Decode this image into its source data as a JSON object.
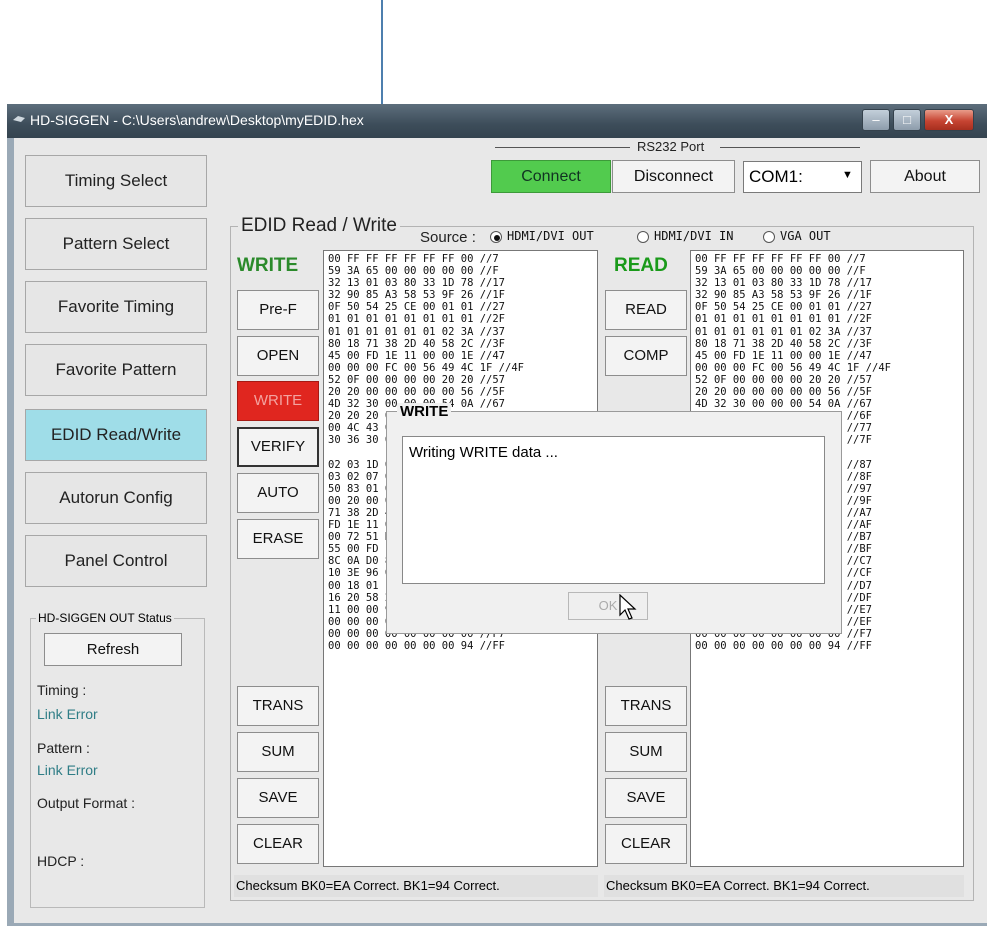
{
  "window": {
    "title": "HD-SIGGEN  - C:\\Users\\andrew\\Desktop\\myEDID.hex",
    "minimize": "–",
    "maximize": "□",
    "close": "X"
  },
  "nav": [
    "Timing Select",
    "Pattern Select",
    "Favorite Timing",
    "Favorite Pattern",
    "EDID Read/Write",
    "Autorun Config",
    "Panel Control"
  ],
  "status": {
    "group_title": "HD-SIGGEN OUT Status",
    "refresh": "Refresh",
    "timing_label": "Timing :",
    "timing_value": "Link Error",
    "pattern_label": "Pattern :",
    "pattern_value": "Link Error",
    "output_label": "Output Format :",
    "hdcp_label": "HDCP :"
  },
  "rs232": {
    "title": "RS232 Port",
    "connect": "Connect",
    "disconnect": "Disconnect",
    "port": "COM1:",
    "about": "About"
  },
  "edid": {
    "title": "EDID Read / Write",
    "source_label": "Source :",
    "sources": [
      "HDMI/DVI OUT",
      "HDMI/DVI IN",
      "VGA OUT"
    ],
    "selected_source": "HDMI/DVI OUT",
    "write_header": "WRITE",
    "read_header": "READ",
    "write_buttons": [
      "Pre-F",
      "OPEN",
      "WRITE",
      "VERIFY",
      "AUTO",
      "ERASE",
      "TRANS",
      "SUM",
      "SAVE",
      "CLEAR"
    ],
    "read_buttons": [
      "READ",
      "COMP",
      "TRANS",
      "SUM",
      "SAVE",
      "CLEAR"
    ],
    "checksum": {
      "write": "Checksum BK0=EA Correct.    BK1=94 Correct.",
      "read": "Checksum BK0=EA Correct.    BK1=94 Correct."
    },
    "hex_lines": [
      "00 FF FF FF FF FF FF 00 //7",
      "59 3A 65 00 00 00 00 00 //F",
      "32 13 01 03 80 33 1D 78 //17",
      "32 90 85 A3 58 53 9F 26 //1F",
      "0F 50 54 25 CE 00 01 01 //27",
      "01 01 01 01 01 01 01 01 //2F",
      "01 01 01 01 01 01 02 3A //37",
      "80 18 71 38 2D 40 58 2C //3F",
      "45 00 FD 1E 11 00 00 1E //47",
      "00 00 00 FC 00 56 49 4C 1F //4F",
      "52 0F 00 00 00 00 20 20 //57",
      "20 20 00 00 00 00 00 56 //5F",
      "4D 32 30 00 00 00 54 0A //67",
      "20 20 20 00 00 00 00 FF //6F",
      "00 4C 43 00 00 00 43 41 //77",
      "30 36 30 00 00 00 01 EA //7F",
      "",
      "02 03 1D 00 00 00 05 04 //87",
      "03 02 07 00 00 00 11 07 //8F",
      "50 83 01 00 00 00 03 0C //97",
      "00 20 00 00 00 00 80 18 //9F",
      "71 38 2D 40 58 2C 25 00 //A7",
      "FD 1E 11 00 00 1E 01 1D //AF",
      "00 72 51 D0 1E 20 6E 28 //B7",
      "55 00 FD 1E 11 00 00 1E //BF",
      "8C 0A D0 8A 20 E0 2D 10 //C7",
      "10 3E 96 00 FD 1E 11 00 //CF",
      "00 18 01 1D 80 18 71 1C //D7",
      "16 20 58 2C 25 00 FD 1E //DF",
      "11 00 00 9E 00 00 00 00 //E7",
      "00 00 00 00 00 00 00 00 //EF",
      "00 00 00 00 00 00 00 00 //F7",
      "00 00 00 00 00 00 00 94 //FF"
    ]
  },
  "dialog": {
    "title": "WRITE",
    "message": "Writing WRITE data ...",
    "ok": "OK"
  }
}
